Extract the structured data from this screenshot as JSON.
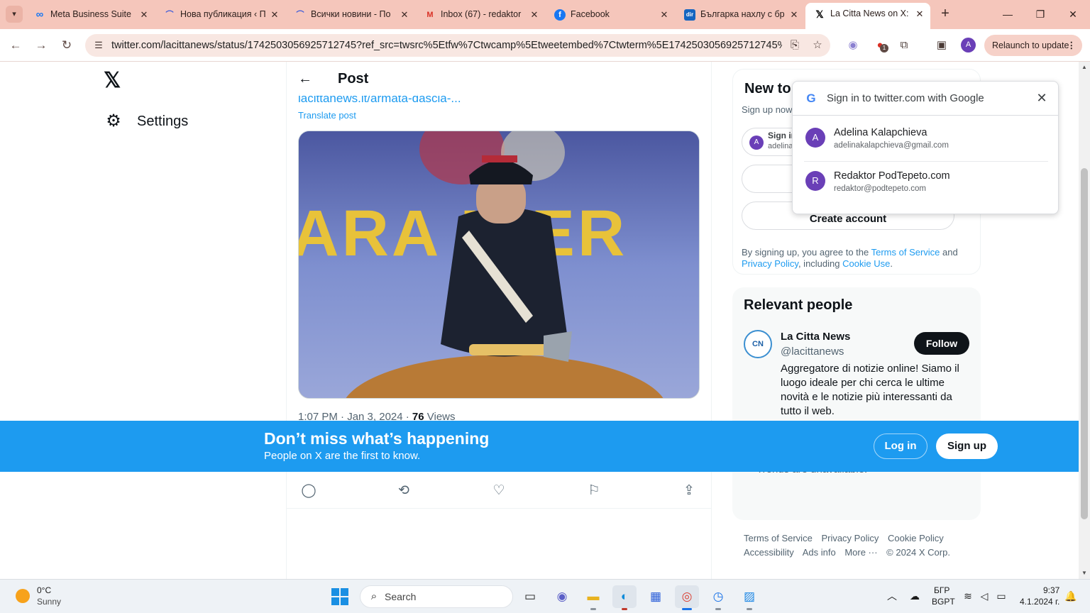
{
  "browser": {
    "tabs": [
      {
        "title": "Meta Business Suite",
        "icon": "meta-icon",
        "color": "#1877f2",
        "glyph": "∞"
      },
      {
        "title": "Нова публикация ‹ П",
        "icon": "wordpress-arc-icon",
        "color": "#3b5bdb",
        "glyph": "⌒"
      },
      {
        "title": "Всички новини - По",
        "icon": "wordpress-arc-icon",
        "color": "#3b5bdb",
        "glyph": "⌒"
      },
      {
        "title": "Inbox (67) - redaktor",
        "icon": "gmail-icon",
        "color": "#d93025",
        "glyph": "M"
      },
      {
        "title": "Facebook",
        "icon": "facebook-icon",
        "color": "#1877f2",
        "glyph": "f"
      },
      {
        "title": "Българка нахлу с бр",
        "icon": "dir-icon",
        "color": "#1565c0",
        "glyph": "dir"
      },
      {
        "title": "La Citta News on X: \"",
        "icon": "x-icon",
        "color": "#000000",
        "glyph": "𝕏"
      }
    ],
    "url": "twitter.com/lacittanews/status/1742503056925712745?ref_src=twsrc%5Etfw%7Ctwcamp%5Etweetembed%7Ctwterm%5E1742503056925712745%7Ctw...",
    "relaunch_label": "Relaunch to update",
    "profile_initial": "A",
    "extension_badge": "1"
  },
  "left_nav": {
    "logo": "𝕏",
    "settings_label": "Settings"
  },
  "post": {
    "header_title": "Post",
    "truncated_link": "lacittanews.it/armata-dascia-...",
    "translate_label": "Translate post",
    "image_text": "ARA  NIER",
    "meta_time": "1:07 PM · Jan 3, 2024 · ",
    "meta_views_count": "76",
    "meta_views_label": " Views"
  },
  "signup": {
    "heading": "New to",
    "sub": "Sign up now",
    "google_btn_name": "Sign in",
    "google_btn_email": "adelina",
    "create_account": "Create account",
    "terms_pre": "By signing up, you agree to the ",
    "terms_link": "Terms of Service",
    "terms_and": " and ",
    "privacy_link": "Privacy Policy",
    "terms_mid": ", including ",
    "cookie_link": "Cookie Use",
    "terms_end": "."
  },
  "google_one_tap": {
    "title": "Sign in to twitter.com with Google",
    "accounts": [
      {
        "initial": "A",
        "name": "Adelina Kalapchieva",
        "email": "adelinakalapchieva@gmail.com"
      },
      {
        "initial": "R",
        "name": "Redaktor PodTepeto.com",
        "email": "redaktor@podtepeto.com"
      }
    ]
  },
  "relevant_people": {
    "heading": "Relevant people",
    "name": "La Citta News",
    "handle": "@lacittanews",
    "bio": "Aggregatore di notizie online! Siamo il luogo ideale per chi cerca le ultime novità e le notizie più interessanti da tutto il web.",
    "follow_label": "Follow",
    "avatar_text": "CN"
  },
  "trends_note": "Trends are unavailable.",
  "footer": {
    "links": [
      "Terms of Service",
      "Privacy Policy",
      "Cookie Policy",
      "Accessibility",
      "Ads info",
      "More ···",
      "© 2024 X Corp."
    ]
  },
  "banner": {
    "heading": "Don’t miss what’s happening",
    "sub": "People on X are the first to know.",
    "login_label": "Log in",
    "signup_label": "Sign up"
  },
  "taskbar": {
    "weather_temp": "0°C",
    "weather_desc": "Sunny",
    "search_label": "Search",
    "lang_line1": "БГР",
    "lang_line2": "BGPT",
    "time": "9:37",
    "date": "4.1.2024 г."
  }
}
